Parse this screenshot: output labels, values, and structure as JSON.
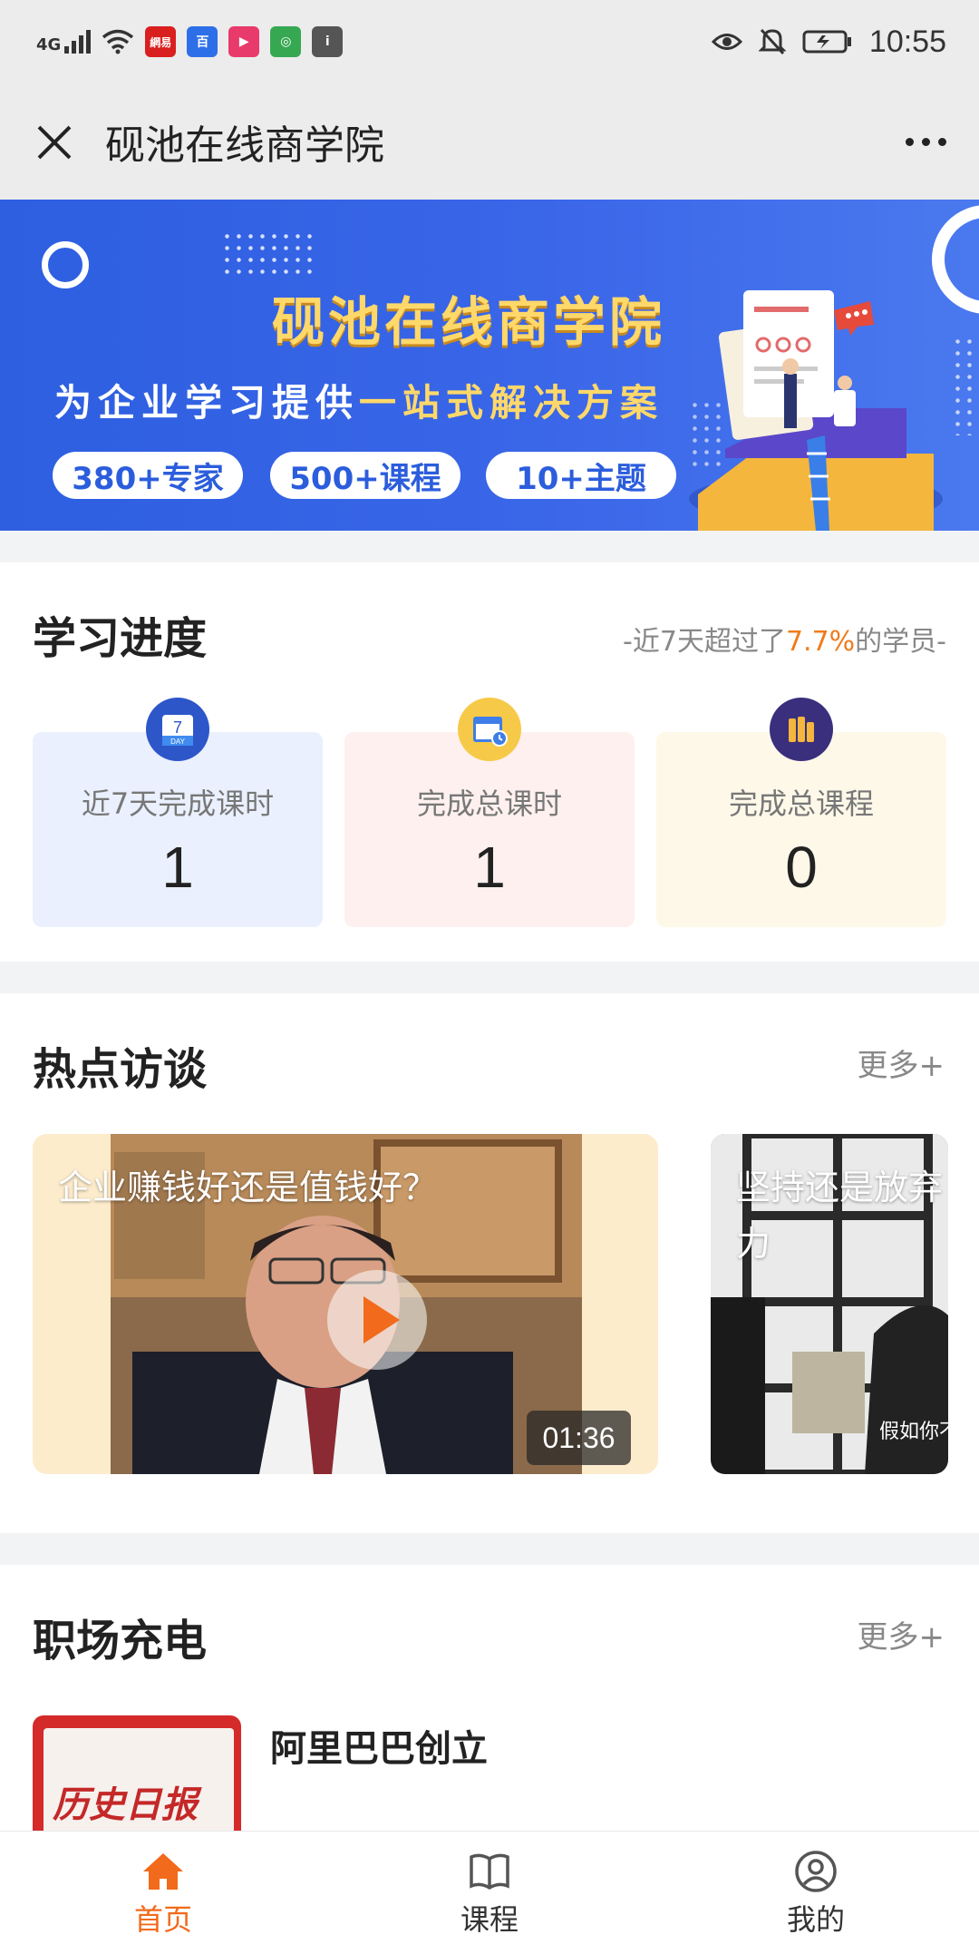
{
  "status_bar": {
    "network": "4G",
    "time": "10:55",
    "apps": [
      {
        "name": "netease-news-app-icon",
        "label": "網易",
        "color": "#d9201f"
      },
      {
        "name": "baidu-app-icon",
        "label": "百",
        "color": "#2d6fe8"
      },
      {
        "name": "youku-app-icon",
        "label": "▶",
        "color": "#e83a6b"
      },
      {
        "name": "browser-app-icon",
        "label": "◎",
        "color": "#36a852"
      },
      {
        "name": "info-app-icon",
        "label": "i",
        "color": "#555555"
      }
    ]
  },
  "titlebar": {
    "title": "砚池在线商学院"
  },
  "banner": {
    "title": "砚池在线商学院",
    "subtitle_pre": "为企业学习提供",
    "subtitle_hl": "一站式解决方案",
    "pills": [
      "380+专家",
      "500+课程",
      "10+主题"
    ]
  },
  "progress": {
    "heading": "学习进度",
    "note_pre": "-近7天超过了",
    "note_hl": "7.7%",
    "note_post": "的学员-",
    "cards": [
      {
        "label": "近7天完成课时",
        "value": "1",
        "bg": "#eaf0fd",
        "icon_bg": "#2d56c9",
        "icon_day": "7",
        "icon_txt": "DAY"
      },
      {
        "label": "完成总课时",
        "value": "1",
        "bg": "#fdf0ee",
        "icon_bg": "#f7c948"
      },
      {
        "label": "完成总课程",
        "value": "0",
        "bg": "#fef8e9",
        "icon_bg": "#3a2f7c"
      }
    ]
  },
  "interviews": {
    "heading": "热点访谈",
    "more": "更多+",
    "videos": [
      {
        "title": "企业赚钱好还是值钱好？",
        "duration": "01:36"
      },
      {
        "title": "坚持还是放弃",
        "title2": "力",
        "caption": "假如你不"
      }
    ]
  },
  "career": {
    "heading": "职场充电",
    "more": "更多+",
    "items": [
      {
        "title": "阿里巴巴创立",
        "thumb_text": "历史日报"
      }
    ]
  },
  "nav": {
    "items": [
      {
        "label": "首页",
        "icon": "home-icon",
        "active": true
      },
      {
        "label": "课程",
        "icon": "book-icon",
        "active": false
      },
      {
        "label": "我的",
        "icon": "user-icon",
        "active": false
      }
    ]
  },
  "colors": {
    "accent": "#f26a1b",
    "brand_blue": "#2d5fe0",
    "highlight": "#f07b1a"
  }
}
